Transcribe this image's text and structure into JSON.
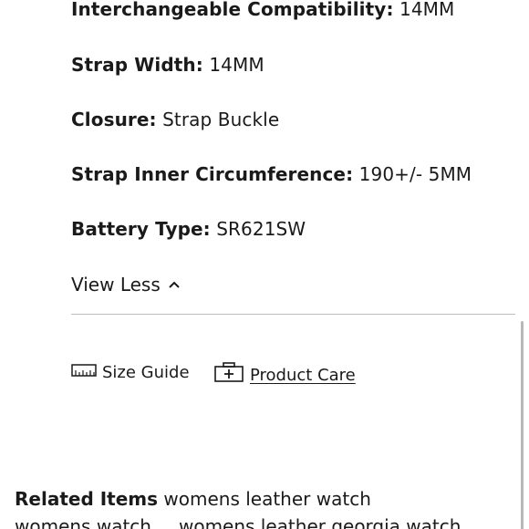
{
  "specs": [
    {
      "label": "Interchangeable Compatibility:",
      "value": "14MM"
    },
    {
      "label": "Strap Width:",
      "value": "14MM"
    },
    {
      "label": "Closure:",
      "value": "Strap Buckle"
    },
    {
      "label": "Strap Inner Circumference:",
      "value": "190+/- 5MM"
    },
    {
      "label": "Battery Type:",
      "value": "SR621SW"
    }
  ],
  "view_less": {
    "label": "View Less",
    "icon": "chevron-up-icon"
  },
  "links": {
    "size_guide": {
      "label": "Size Guide",
      "icon": "ruler-icon"
    },
    "product_care": {
      "label": "Product Care",
      "icon": "first-aid-kit-icon"
    }
  },
  "related": {
    "heading": "Related Items",
    "items": [
      "womens leather watch",
      "womens watch",
      "womens leather georgia watch"
    ]
  }
}
